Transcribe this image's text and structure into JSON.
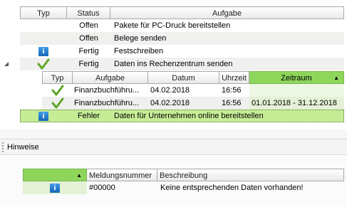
{
  "tasks": {
    "columns": [
      "Typ",
      "Status",
      "Aufgabe"
    ],
    "rows": [
      {
        "icon": "",
        "status": "Offen",
        "task": "Pakete für PC-Druck bereitstellen"
      },
      {
        "icon": "",
        "status": "Offen",
        "task": "Belege senden"
      },
      {
        "icon": "info-icon",
        "status": "Fertig",
        "task": "Festschreiben"
      },
      {
        "icon": "checkmark-icon",
        "status": "Fertig",
        "task": "Daten ins Rechenzentrum senden"
      }
    ],
    "sub": {
      "columns": [
        "Typ",
        "Aufgabe",
        "Datum",
        "Uhrzeit",
        "Zeitraum"
      ],
      "rows": [
        {
          "icon": "checkmark-icon",
          "task": "Finanzbuchführu...",
          "date": "04.02.2018",
          "time": "16:56",
          "period": ""
        },
        {
          "icon": "checkmark-icon",
          "task": "Finanzbuchführu...",
          "date": "04.02.2018",
          "time": "16:56",
          "period": "01.01.2018 - 31.12.2018"
        }
      ]
    },
    "last": {
      "icon": "info-icon",
      "status": "Fehler",
      "task": "Daten für Unternehmen online bereitstellen"
    }
  },
  "panel": {
    "title": "Hinweise"
  },
  "messages": {
    "columns": [
      "",
      "Meldungsnummer",
      "Beschreibung"
    ],
    "rows": [
      {
        "icon": "info-icon",
        "number": "#00000",
        "description": "Keine entsprechenden Daten vorhanden!"
      }
    ]
  },
  "colors": {
    "highlight": "#c6ed96",
    "header_highlight": "#8ed65b",
    "shade": "#f0f0ee"
  }
}
